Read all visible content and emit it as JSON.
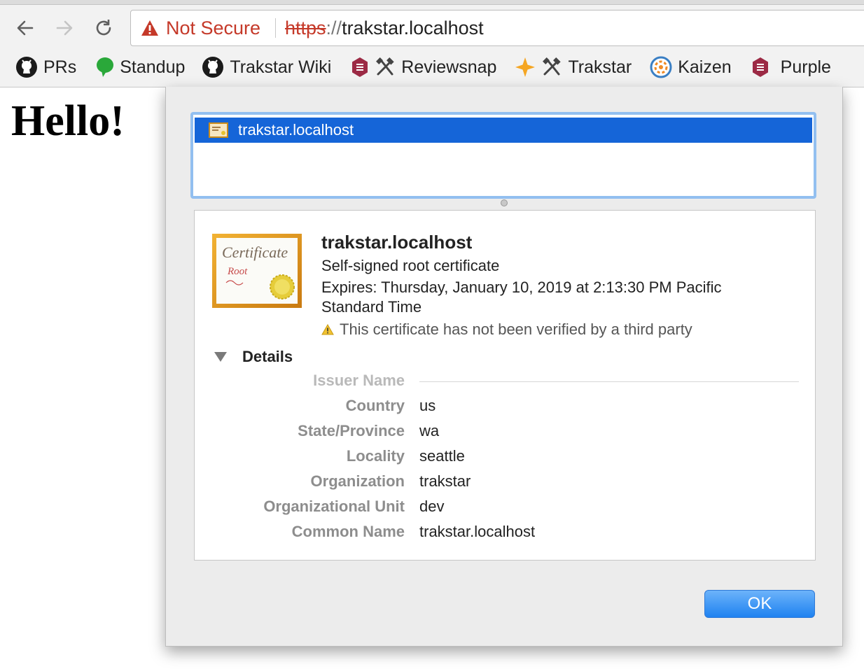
{
  "browser": {
    "security_label": "Not Secure",
    "url_scheme": "https",
    "url_separator": "://",
    "url_host": "trakstar.localhost"
  },
  "bookmarks": [
    {
      "label": "PRs",
      "icon": "github-icon"
    },
    {
      "label": "Standup",
      "icon": "chat-bubble-icon"
    },
    {
      "label": "Trakstar Wiki",
      "icon": "github-icon"
    },
    {
      "label": "Reviewsnap",
      "icon": "tools-icon"
    },
    {
      "label": "Trakstar",
      "icon": "tools-icon"
    },
    {
      "label": "Kaizen",
      "icon": "kaizen-icon"
    },
    {
      "label": "Purple",
      "icon": "hexagon-icon"
    }
  ],
  "page": {
    "heading": "Hello!"
  },
  "certificate": {
    "list_item": "trakstar.localhost",
    "title": "trakstar.localhost",
    "subtitle": "Self-signed root certificate",
    "expires": "Expires: Thursday, January 10, 2019 at 2:13:30 PM Pacific Standard Time",
    "warning": "This certificate has not been verified by a third party",
    "details_label": "Details",
    "fields": [
      {
        "key": "Issuer Name",
        "value": ""
      },
      {
        "key": "Country",
        "value": "us"
      },
      {
        "key": "State/Province",
        "value": "wa"
      },
      {
        "key": "Locality",
        "value": "seattle"
      },
      {
        "key": "Organization",
        "value": "trakstar"
      },
      {
        "key": "Organizational Unit",
        "value": "dev"
      },
      {
        "key": "Common Name",
        "value": "trakstar.localhost"
      }
    ]
  },
  "dialog": {
    "ok_label": "OK"
  },
  "colors": {
    "not_secure": "#c53929",
    "selection": "#1565d8",
    "ok_button": "#1f82f0"
  }
}
